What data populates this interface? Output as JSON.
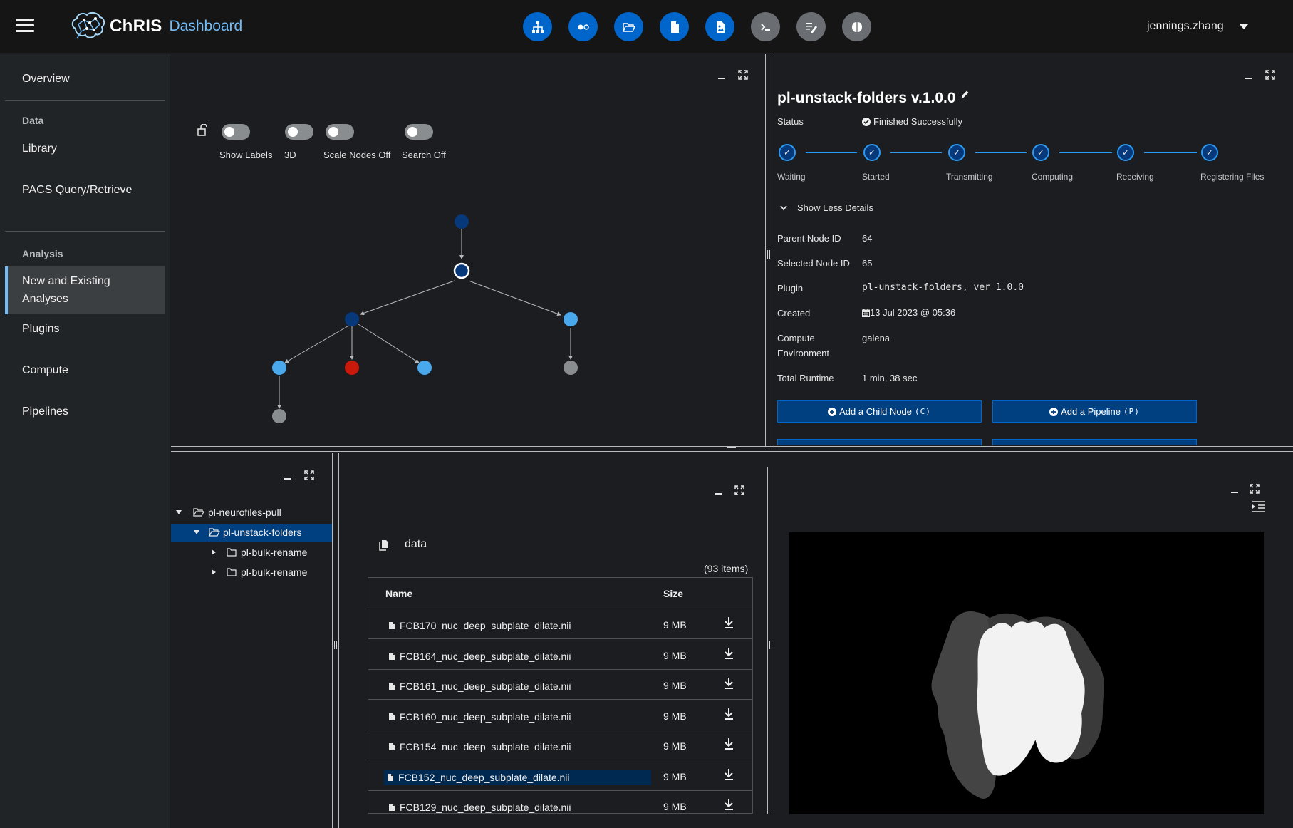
{
  "header": {
    "brand": "ChRIS",
    "subtitle": "Dashboard",
    "user": "jennings.zhang",
    "icons": [
      "sitemap-icon",
      "dots-icon",
      "folder-open-icon",
      "file-icon",
      "file-image-icon",
      "terminal-icon",
      "file-edit-icon",
      "brain-icon"
    ]
  },
  "sidebar": {
    "overview": "Overview",
    "data_section": "Data",
    "library": "Library",
    "pacs": "PACS Query/Retrieve",
    "analysis_section": "Analysis",
    "analyses_line1": "New and Existing",
    "analyses_line2": "Analyses",
    "plugins": "Plugins",
    "compute": "Compute",
    "pipelines": "Pipelines"
  },
  "graph": {
    "toggles": {
      "show_labels": "Show Labels",
      "three_d": "3D",
      "scale_nodes": "Scale Nodes Off",
      "search": "Search Off"
    },
    "colors": {
      "dark": "#06387a",
      "light": "#4aa8ec",
      "error": "#c9190b",
      "grey": "#8a8d90",
      "selected_fill": "#06387a",
      "selected_ring": "#ffffff"
    }
  },
  "details": {
    "title": "pl-unstack-folders v.1.0.0",
    "status_label": "Status",
    "status_value": "Finished Successfully",
    "steps": [
      "Waiting",
      "Started",
      "Transmitting",
      "Computing",
      "Receiving",
      "Registering Files"
    ],
    "toggle_details": "Show Less Details",
    "fields": {
      "parent_label": "Parent Node ID",
      "parent_value": "64",
      "selected_label": "Selected Node ID",
      "selected_value": "65",
      "plugin_label": "Plugin",
      "plugin_value": "pl-unstack-folders, ver 1.0.0",
      "created_label": "Created",
      "created_value": "13 Jul 2023 @ 05:36",
      "compute_label_1": "Compute",
      "compute_label_2": "Environment",
      "compute_value": "galena",
      "runtime_label": "Total Runtime",
      "runtime_value": "1 min, 38 sec"
    },
    "buttons": {
      "add_child": "Add a Child Node",
      "add_child_key": "(C)",
      "add_pipeline": "Add a Pipeline",
      "add_pipeline_key": "(P)"
    }
  },
  "tree": {
    "root": "pl-neurofiles-pull",
    "selected": "pl-unstack-folders",
    "children": [
      "pl-bulk-rename",
      "pl-bulk-rename"
    ]
  },
  "files": {
    "folder": "data",
    "count": "(93 items)",
    "col_name": "Name",
    "col_size": "Size",
    "rows": [
      {
        "name": "FCB170_nuc_deep_subplate_dilate.nii",
        "size": "9 MB"
      },
      {
        "name": "FCB164_nuc_deep_subplate_dilate.nii",
        "size": "9 MB"
      },
      {
        "name": "FCB161_nuc_deep_subplate_dilate.nii",
        "size": "9 MB"
      },
      {
        "name": "FCB160_nuc_deep_subplate_dilate.nii",
        "size": "9 MB"
      },
      {
        "name": "FCB154_nuc_deep_subplate_dilate.nii",
        "size": "9 MB"
      },
      {
        "name": "FCB152_nuc_deep_subplate_dilate.nii",
        "size": "9 MB"
      },
      {
        "name": "FCB129_nuc_deep_subplate_dilate.nii",
        "size": "9 MB"
      }
    ]
  }
}
